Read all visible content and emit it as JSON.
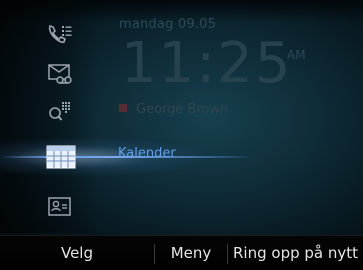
{
  "home_screen": {
    "date": "mandag 09.05",
    "time": "11:25",
    "ampm": "AM",
    "contact_name": "George Brown"
  },
  "main_menu": {
    "selected_label": "Kalender",
    "items": [
      {
        "icon": "call-log-icon"
      },
      {
        "icon": "voicemail-icon"
      },
      {
        "icon": "search-directory-icon"
      },
      {
        "icon": "calendar-icon"
      },
      {
        "icon": "contacts-icon"
      }
    ]
  },
  "softkeys": {
    "left": "Velg",
    "middle": "Meny",
    "right": "Ring opp på nytt"
  },
  "colors": {
    "accent": "#5fa0ea",
    "icon_gray": "#9aa4aa",
    "selected_icon": "#d6e6ff",
    "softkey_text": "#e6e6e6"
  }
}
